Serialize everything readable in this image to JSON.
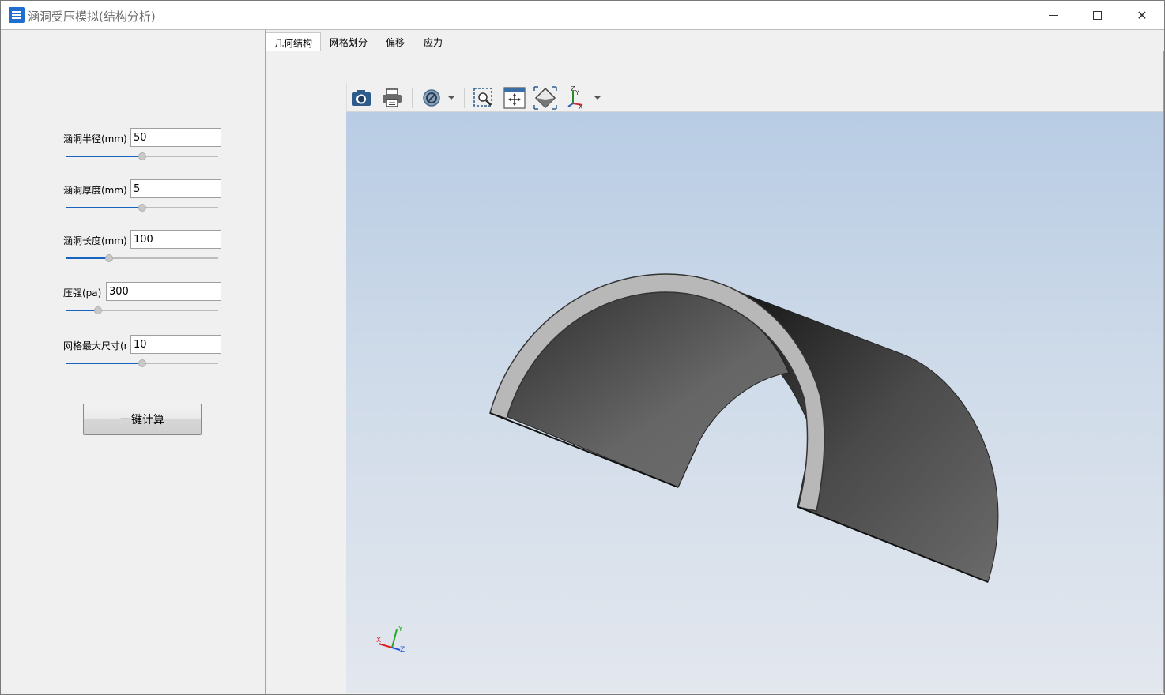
{
  "window": {
    "title": "涵洞受压模拟(结构分析)",
    "controls": {
      "minimize_icon": "minimize-icon",
      "maximize_icon": "maximize-icon",
      "close_icon": "close-icon"
    },
    "close_glyph": "✕"
  },
  "params": [
    {
      "label": "涵洞半径(mm)",
      "value": "50",
      "slider_fraction": 0.5
    },
    {
      "label": "涵洞厚度(mm)",
      "value": "5",
      "slider_fraction": 0.5
    },
    {
      "label": "涵洞长度(mm)",
      "value": "100",
      "slider_fraction": 0.28
    },
    {
      "label": "压强(pa)",
      "value": "300",
      "slider_fraction": 0.21
    },
    {
      "label": "网格最大尺寸(mm)",
      "value": "10",
      "slider_fraction": 0.5
    }
  ],
  "calc_button": "一键计算",
  "tabs": [
    "几何结构",
    "网格划分",
    "偏移",
    "应力"
  ],
  "active_tab": 0,
  "toolbar": {
    "icons": [
      "camera-icon",
      "print-icon",
      "display-mode-icon",
      "zoom-box-icon",
      "fit-all-icon",
      "view-iso-icon",
      "axis-view-icon"
    ]
  },
  "viewer": {
    "colors": {
      "accent": "#1565c0",
      "shell_dark": "#3a3a3a",
      "shell_mid": "#6a6a6a",
      "shell_edge": "#b5b5b5"
    },
    "triad": {
      "x": "X",
      "y": "Y",
      "z": "Z"
    }
  }
}
